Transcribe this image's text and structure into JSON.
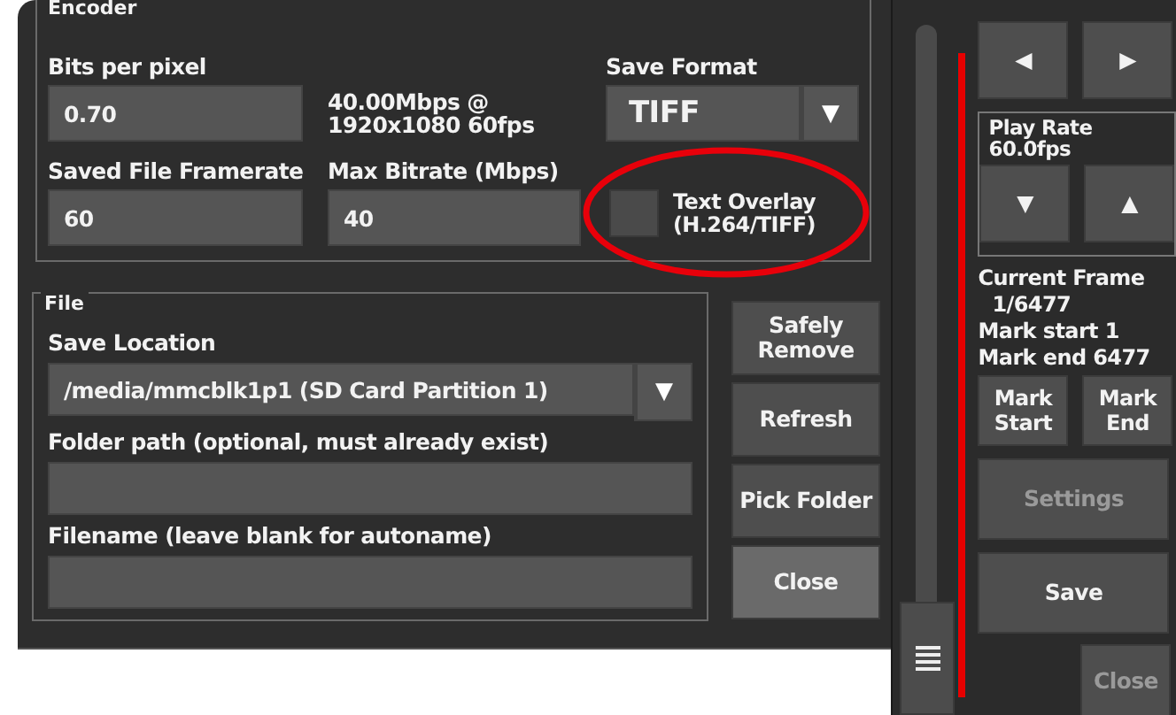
{
  "encoder": {
    "title": "Encoder",
    "bits_per_pixel": {
      "label": "Bits per pixel",
      "value": "0.70"
    },
    "bitrate_info": "40.00Mbps @ 1920x1080 60fps",
    "save_format": {
      "label": "Save Format",
      "value": "TIFF",
      "arrow": "▼"
    },
    "framerate": {
      "label": "Saved File Framerate",
      "value": "60"
    },
    "max_bitrate": {
      "label": "Max Bitrate (Mbps)",
      "value": "40"
    },
    "text_overlay": {
      "label": "Text Overlay (H.264/TIFF)",
      "checked": false
    }
  },
  "file": {
    "title": "File",
    "save_location": {
      "label": "Save Location",
      "value": "/media/mmcblk1p1 (SD Card Partition 1)",
      "arrow": "▼"
    },
    "folder_path": {
      "label": "Folder path (optional, must already exist)"
    },
    "filename": {
      "label": "Filename (leave blank for autoname)"
    }
  },
  "dialog_buttons": [
    {
      "label": "Safely Remove",
      "highlighted": false
    },
    {
      "label": "Refresh",
      "highlighted": false
    },
    {
      "label": "Pick Folder",
      "highlighted": false
    },
    {
      "label": "Close",
      "highlighted": true
    }
  ],
  "controls": {
    "seek": {
      "level": 0
    },
    "prev": "◀",
    "next": "▶",
    "play_rate": {
      "title": "Play Rate",
      "value": "60.0fps",
      "down": "▼",
      "up": "▲"
    },
    "current_frame": {
      "label": "Current Frame",
      "value": "1/6477"
    },
    "mark_start_info": "Mark start 1",
    "mark_end_info": "Mark end 6477",
    "buttons": [
      {
        "label": "Mark Start",
        "disabled": false,
        "kind": "mark"
      },
      {
        "label": "Mark End",
        "disabled": false,
        "kind": "mark"
      },
      {
        "label": "Settings",
        "disabled": true,
        "kind": "wide"
      },
      {
        "label": "Save",
        "disabled": false,
        "kind": "wide"
      }
    ],
    "close": {
      "label": "Close",
      "disabled": true
    }
  }
}
